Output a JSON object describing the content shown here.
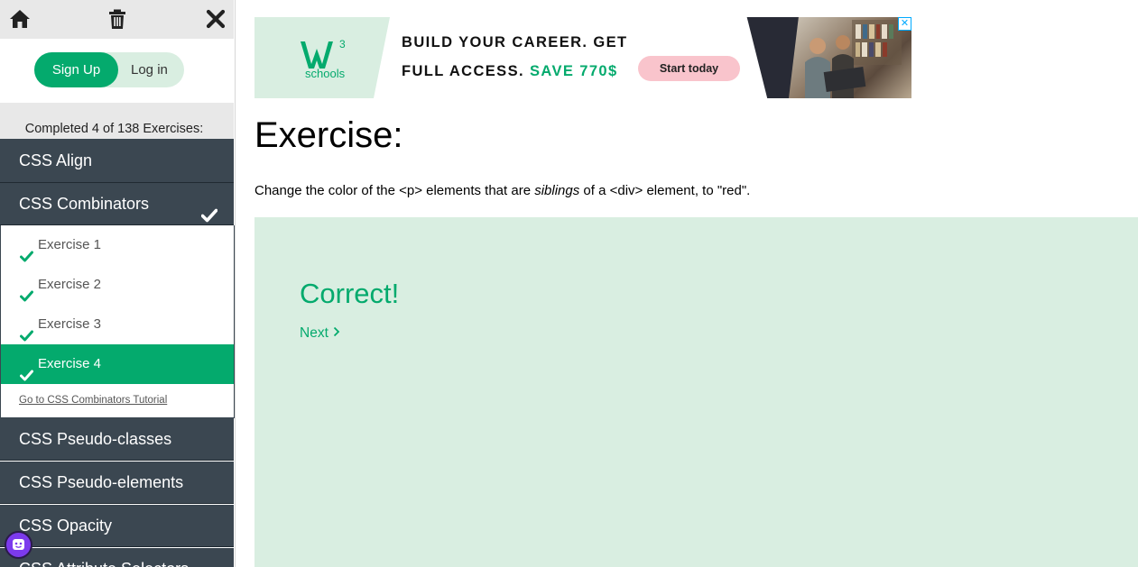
{
  "sidebar": {
    "auth": {
      "signup": "Sign Up",
      "login": "Log in"
    },
    "progress": "Completed 4 of 138 Exercises:",
    "sections": [
      {
        "label": "CSS Align"
      },
      {
        "label": "CSS Combinators"
      },
      {
        "label": "CSS Pseudo-classes"
      },
      {
        "label": "CSS Pseudo-elements"
      },
      {
        "label": "CSS Opacity"
      },
      {
        "label": "CSS Attribute Selectors"
      }
    ],
    "exercises": [
      "Exercise 1",
      "Exercise 2",
      "Exercise 3",
      "Exercise 4"
    ],
    "tutorial_link": "Go to CSS Combinators Tutorial",
    "icons": [
      "home-icon",
      "trash-icon",
      "close-icon",
      "chat-icon",
      "check-icon"
    ]
  },
  "ad": {
    "logo_text": "schools",
    "logo_mark": "W",
    "logo_sup": "3",
    "line1": "BUILD YOUR CAREER. GET",
    "line2": "FULL ACCESS.",
    "line2_save": "SAVE 770$",
    "cta": "Start today"
  },
  "main": {
    "title": "Exercise:",
    "instruction_before": "Change the color of the <p> elements that are ",
    "instruction_em": "siblings",
    "instruction_after": " of a <div> element, to \"red\".",
    "result_title": "Correct!",
    "next_label": "Next"
  },
  "colors": {
    "accent": "#04aa6d",
    "sidebar_dark": "#3b4751",
    "result_bg": "#d9eee1"
  }
}
